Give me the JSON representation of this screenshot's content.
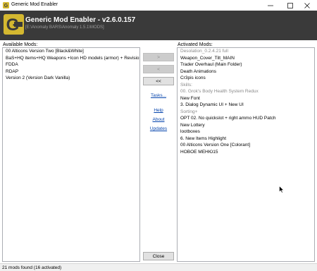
{
  "window": {
    "title": "Generic Mod Enabler",
    "controls": [
      "minimize",
      "maximize",
      "close"
    ]
  },
  "header": {
    "title": "Generic Mod Enabler - v2.6.0.157",
    "path": "[E:\\Anomaly BARS\\Anomaly 1.5.1\\MODS]",
    "background": "#3a3a3a",
    "logo_color": "#d4b830"
  },
  "available": {
    "label": "Available Mods:",
    "items": [
      "00 Alticons Version Two [Black&White]",
      "BaS+HQ items+HQ Weapons +Icon HD models (armor) + Revisio...",
      "FDDA",
      "RDAP",
      "Version 2 (Version Dark Vanilla)"
    ]
  },
  "activated": {
    "label": "Activated Mods:",
    "items": [
      {
        "text": "Desolation_0.2.4.21 full",
        "dim": true
      },
      {
        "text": "Weapon_Cover_Tilt_MAIN",
        "dim": false
      },
      {
        "text": "Trader Overhaul (Main Folder)",
        "dim": false
      },
      {
        "text": "Death Animations",
        "dim": false
      },
      {
        "text": "Cr3pis icons",
        "dim": false
      },
      {
        "text": "Skills:",
        "dim": true
      },
      {
        "text": "00. Grok's Body Health System Redux",
        "dim": true
      },
      {
        "text": "New Font",
        "dim": false
      },
      {
        "text": "3. Dialog Dynamic UI + New UI",
        "dim": false
      },
      {
        "text": "Sorting+",
        "dim": true
      },
      {
        "text": "OPT 02. No quickslot + right ammo HUD  Patch",
        "dim": false
      },
      {
        "text": "New Lottery",
        "dim": false
      },
      {
        "text": "lootboxes",
        "dim": false
      },
      {
        "text": "6. New Items Highlight",
        "dim": false
      },
      {
        "text": "00 Alticons Version One [Colorant]",
        "dim": false
      },
      {
        "text": "HOBOE MEHЮ15",
        "dim": false
      }
    ]
  },
  "buttons": {
    "move_right": ">",
    "move_left": "<",
    "move_all_left": "<<",
    "close": "Close"
  },
  "links": {
    "tasks": "Tasks...",
    "help": "Help",
    "about": "About",
    "updates": "Updates"
  },
  "status": {
    "text": "21 mods found (16 activated)"
  }
}
